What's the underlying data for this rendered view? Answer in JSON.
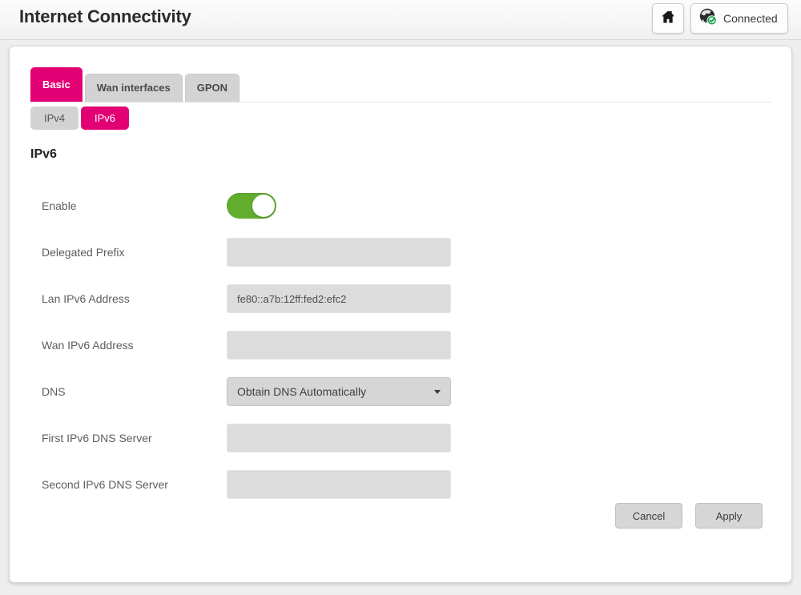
{
  "header": {
    "title": "Internet Connectivity",
    "home_icon": "home-icon",
    "status": {
      "icon": "globe-connected-icon",
      "label": "Connected"
    }
  },
  "tabs": [
    {
      "label": "Basic",
      "active": true
    },
    {
      "label": "Wan interfaces",
      "active": false
    },
    {
      "label": "GPON",
      "active": false
    }
  ],
  "sub_tabs": [
    {
      "label": "IPv4",
      "active": false
    },
    {
      "label": "IPv6",
      "active": true
    }
  ],
  "section": {
    "title": "IPv6"
  },
  "form": {
    "rows": [
      {
        "label": "Enable",
        "type": "toggle",
        "value": "on",
        "placeholder": ""
      },
      {
        "label": "Delegated Prefix",
        "type": "text",
        "value": "",
        "placeholder": ""
      },
      {
        "label": "Lan IPv6 Address",
        "type": "text",
        "value": "fe80::a7b:12ff:fed2:efc2",
        "placeholder": ""
      },
      {
        "label": "Wan IPv6 Address",
        "type": "text",
        "value": "",
        "placeholder": ""
      },
      {
        "label": "DNS",
        "type": "select",
        "value": "Obtain DNS Automatically",
        "placeholder": ""
      },
      {
        "label": "First IPv6 DNS Server",
        "type": "text",
        "value": "",
        "placeholder": ""
      },
      {
        "label": "Second IPv6 DNS Server",
        "type": "text",
        "value": "",
        "placeholder": ""
      }
    ]
  },
  "footer": {
    "cancel_label": "Cancel",
    "apply_label": "Apply"
  },
  "colors": {
    "accent_magenta": "#e20074",
    "toggle_green": "#62ad2d",
    "status_green": "#1f9d45",
    "panel_background": "#ffffff",
    "page_background": "#eeeeee",
    "input_background": "#dcdcdc"
  }
}
